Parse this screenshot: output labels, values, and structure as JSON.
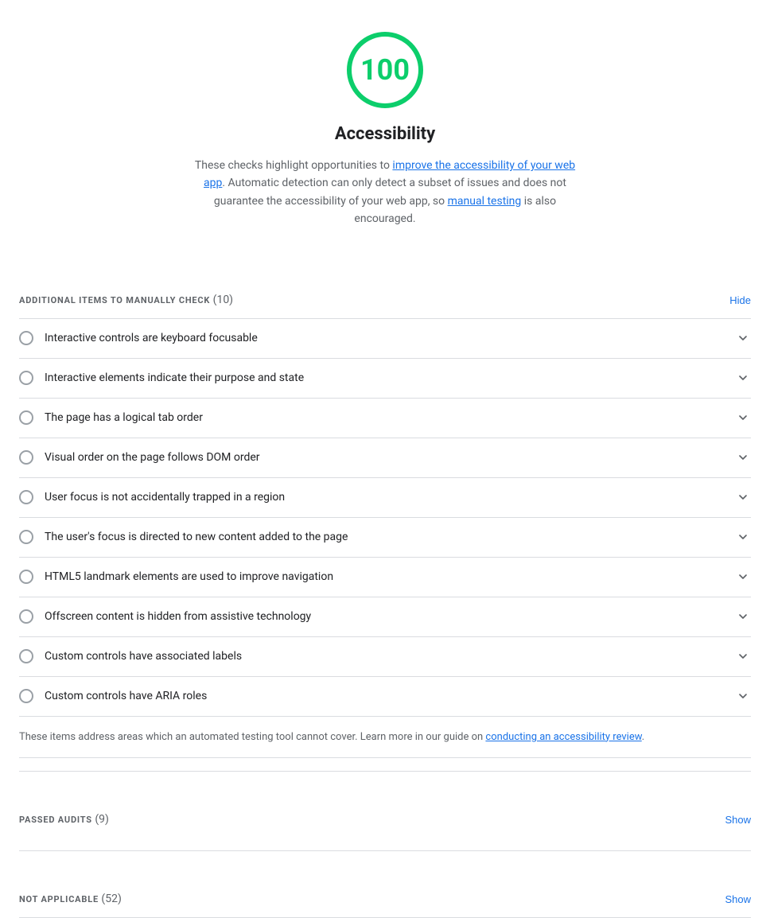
{
  "score": {
    "value": "100",
    "color": "#0cce6b",
    "title": "Accessibility",
    "description_before": "These checks highlight opportunities to ",
    "description_link1_text": "improve the accessibility of your web app",
    "description_middle": ". Automatic detection can only detect a subset of issues and does not guarantee the accessibility of your web app, so ",
    "description_link2_text": "manual testing",
    "description_after": " is also encouraged."
  },
  "manual_section": {
    "label": "ADDITIONAL ITEMS TO MANUALLY CHECK",
    "count": "(10)",
    "toggle_label": "Hide"
  },
  "audit_items": [
    {
      "text": "Interactive controls are keyboard focusable"
    },
    {
      "text": "Interactive elements indicate their purpose and state"
    },
    {
      "text": "The page has a logical tab order"
    },
    {
      "text": "Visual order on the page follows DOM order"
    },
    {
      "text": "User focus is not accidentally trapped in a region"
    },
    {
      "text": "The user's focus is directed to new content added to the page"
    },
    {
      "text": "HTML5 landmark elements are used to improve navigation"
    },
    {
      "text": "Offscreen content is hidden from assistive technology"
    },
    {
      "text": "Custom controls have associated labels"
    },
    {
      "text": "Custom controls have ARIA roles"
    }
  ],
  "manual_footer": {
    "text_before": "These items address areas which an automated testing tool cannot cover. Learn more in our guide on ",
    "link_text": "conducting an accessibility review",
    "text_after": "."
  },
  "passed_section": {
    "label": "PASSED AUDITS",
    "count": "(9)",
    "toggle_label": "Show"
  },
  "not_applicable_section": {
    "label": "NOT APPLICABLE",
    "count": "(52)",
    "toggle_label": "Show"
  }
}
